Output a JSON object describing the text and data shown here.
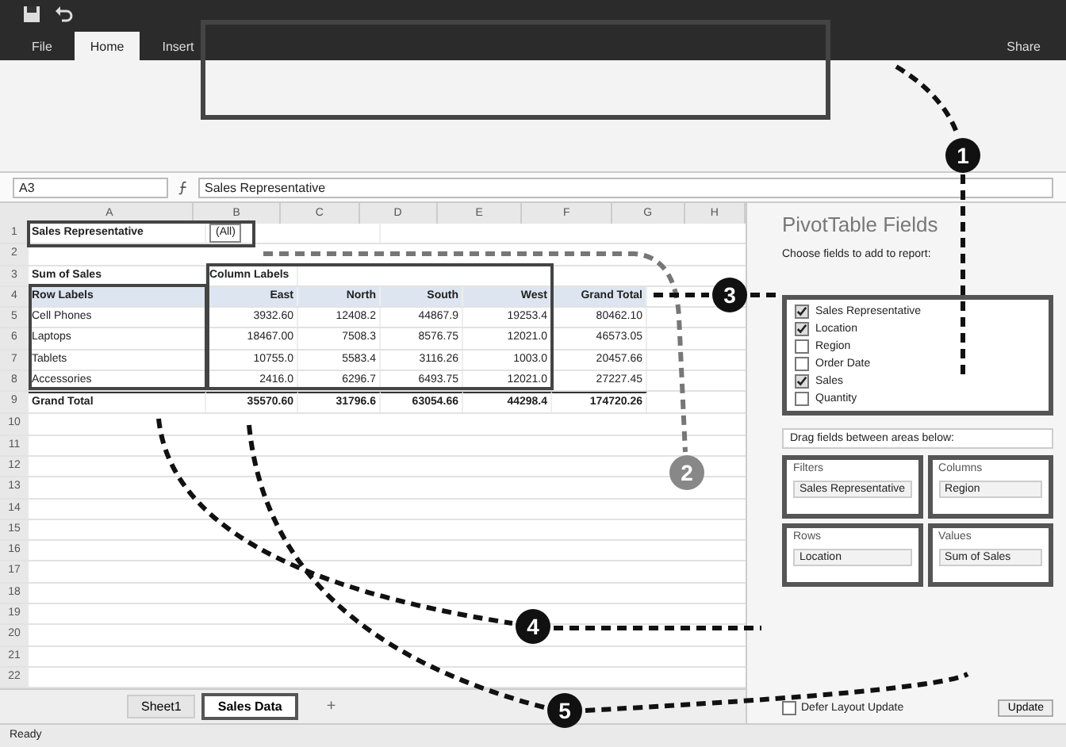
{
  "ribbon": {
    "tabs": [
      {
        "label": "File",
        "selected": false
      },
      {
        "label": "Home",
        "selected": true
      },
      {
        "label": "Insert",
        "selected": false
      }
    ],
    "share": "Share"
  },
  "formula_bar": {
    "name_box": "A3",
    "value": "Sales Representative"
  },
  "sheet": {
    "column_letters": [
      "A",
      "B",
      "C",
      "D",
      "E",
      "F",
      "G",
      "H"
    ],
    "row_numbers": [
      "1",
      "2",
      "3",
      "4",
      "5",
      "6",
      "7",
      "8",
      "9",
      "10",
      "11",
      "12",
      "13",
      "14",
      "15",
      "16",
      "17",
      "18",
      "19",
      "20",
      "21",
      "22"
    ]
  },
  "pivot": {
    "filter": {
      "field": "Sales Representative",
      "value": "(All)"
    },
    "values_caption": "Sum of Sales",
    "columns_caption": "Column Labels",
    "rows_caption": "Row Labels",
    "column_headers": [
      "East",
      "North",
      "South",
      "West",
      "Grand Total"
    ],
    "rows": [
      {
        "label": "Cell Phones",
        "values": [
          "3932.60",
          "12408.2",
          "44867.9",
          "19253.4",
          "80462.10"
        ]
      },
      {
        "label": "Laptops",
        "values": [
          "18467.00",
          "7508.3",
          "8576.75",
          "12021.0",
          "46573.05"
        ]
      },
      {
        "label": "Tablets",
        "values": [
          "10755.0",
          "5583.4",
          "3116.26",
          "1003.0",
          "20457.66"
        ]
      },
      {
        "label": "Accessories",
        "values": [
          "2416.0",
          "6296.7",
          "6493.75",
          "12021.0",
          "27227.45"
        ]
      }
    ],
    "total": {
      "label": "Grand Total",
      "values": [
        "35570.60",
        "31796.6",
        "63054.66",
        "44298.4",
        "174720.26"
      ]
    }
  },
  "fields_pane": {
    "title": "PivotTable Fields",
    "subtitle": "Choose fields to add to report:",
    "fields": [
      {
        "name": "Sales Representative",
        "checked": true
      },
      {
        "name": "Location",
        "checked": true
      },
      {
        "name": "Region",
        "checked": false
      },
      {
        "name": "Order Date",
        "checked": false
      },
      {
        "name": "Sales",
        "checked": true
      },
      {
        "name": "Quantity",
        "checked": false
      }
    ],
    "drag_hint": "Drag fields between areas below:",
    "areas": [
      {
        "title": "Filters",
        "item": "Sales Representative"
      },
      {
        "title": "Columns",
        "item": "Region"
      },
      {
        "title": "Rows",
        "item": "Location"
      },
      {
        "title": "Values",
        "item": "Sum of Sales"
      }
    ],
    "defer": {
      "label": "Defer Layout Update",
      "checked": false
    },
    "update": "Update"
  },
  "sheet_tabs": [
    {
      "label": "Sheet1",
      "selected": false
    },
    {
      "label": "Sales Data",
      "selected": true
    }
  ],
  "add_sheet": "+",
  "status_bar": {
    "text": "Ready"
  },
  "callouts": [
    "1",
    "2",
    "3",
    "4",
    "5"
  ]
}
